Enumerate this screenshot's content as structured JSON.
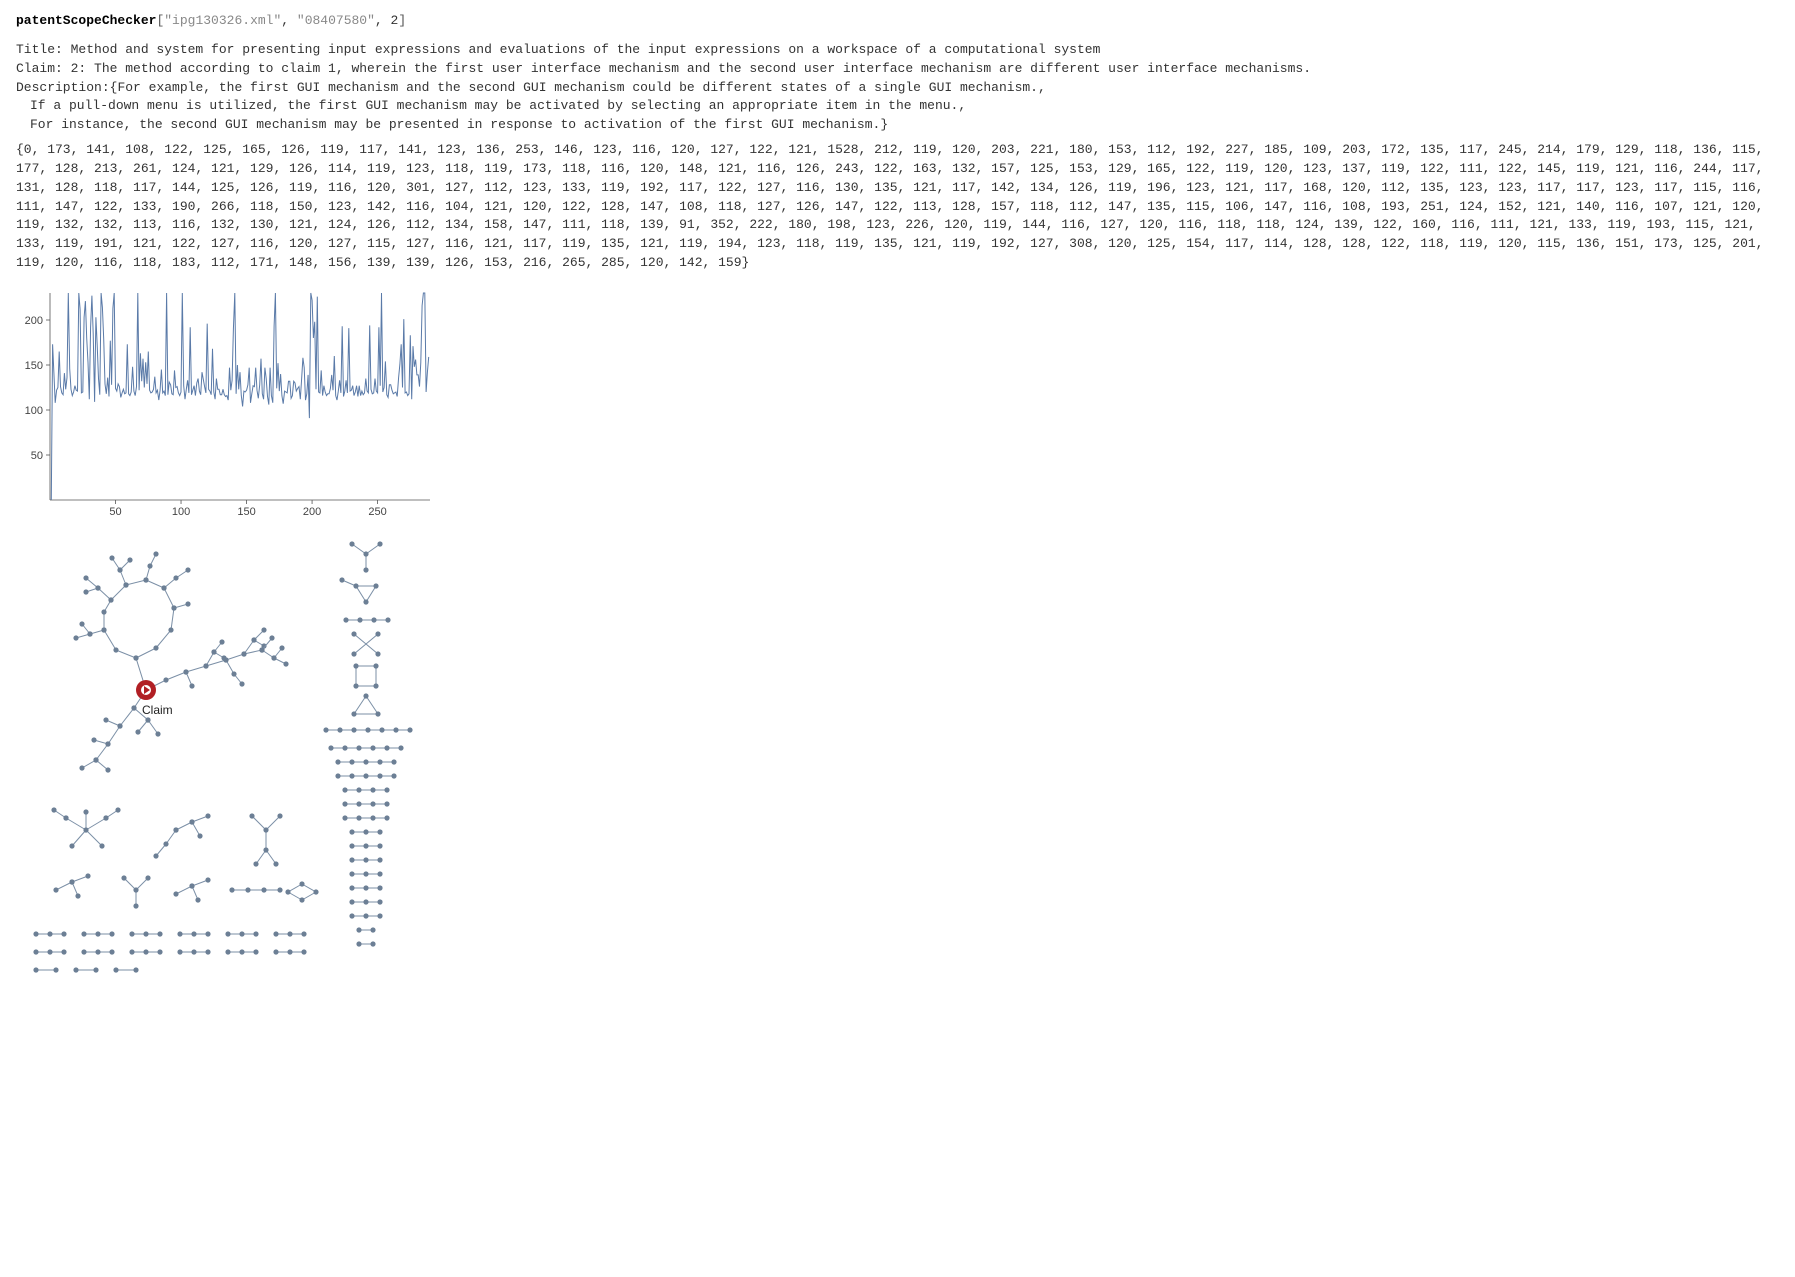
{
  "input": {
    "fn": "patentScopeChecker",
    "arg1": "\"ipg130326.xml\"",
    "arg2": "\"08407580\"",
    "arg3": "2"
  },
  "output": {
    "title_label": "Title: ",
    "title_text": "Method and system for presenting input expressions and evaluations of the input expressions on a workspace of a computational system",
    "claim_label": "Claim: ",
    "claim_text": "2: The method according to claim 1, wherein the first user interface mechanism and the second user interface mechanism are different user interface mechanisms.",
    "desc_label": "Description:",
    "desc_open": "{",
    "desc_items": [
      "For example, the first GUI mechanism and the second GUI mechanism could be different states of a single GUI mechanism.,",
      "If a pull-down menu is utilized, the first GUI mechanism may be activated by selecting an appropriate item in the menu.,",
      "For instance, the second GUI mechanism may be presented in response to activation of the first GUI mechanism."
    ],
    "desc_close": "}"
  },
  "data_list_prefix": "{",
  "data_list_suffix": "}",
  "data_values": [
    0,
    173,
    141,
    108,
    122,
    125,
    165,
    126,
    119,
    117,
    141,
    123,
    136,
    253,
    146,
    123,
    116,
    120,
    127,
    122,
    121,
    1528,
    212,
    119,
    120,
    203,
    221,
    180,
    153,
    112,
    192,
    227,
    185,
    109,
    203,
    172,
    135,
    117,
    245,
    214,
    179,
    129,
    118,
    136,
    115,
    177,
    128,
    213,
    261,
    124,
    121,
    129,
    126,
    114,
    119,
    123,
    118,
    119,
    173,
    118,
    116,
    120,
    148,
    121,
    116,
    126,
    243,
    122,
    163,
    132,
    157,
    125,
    153,
    129,
    165,
    122,
    119,
    120,
    123,
    137,
    119,
    122,
    111,
    122,
    145,
    119,
    121,
    116,
    244,
    117,
    131,
    128,
    118,
    117,
    144,
    125,
    126,
    119,
    116,
    120,
    301,
    127,
    112,
    123,
    133,
    119,
    192,
    117,
    122,
    127,
    116,
    130,
    135,
    121,
    117,
    142,
    134,
    126,
    119,
    196,
    123,
    121,
    117,
    168,
    120,
    112,
    135,
    123,
    123,
    117,
    117,
    123,
    117,
    115,
    116,
    111,
    147,
    122,
    133,
    190,
    266,
    118,
    150,
    123,
    142,
    116,
    104,
    121,
    120,
    122,
    128,
    147,
    108,
    118,
    127,
    126,
    147,
    122,
    113,
    128,
    157,
    118,
    112,
    147,
    135,
    115,
    106,
    147,
    116,
    108,
    193,
    251,
    124,
    152,
    121,
    140,
    116,
    107,
    121,
    120,
    119,
    132,
    132,
    113,
    116,
    132,
    130,
    121,
    124,
    126,
    112,
    134,
    158,
    147,
    111,
    118,
    139,
    91,
    352,
    222,
    180,
    198,
    123,
    226,
    120,
    119,
    144,
    116,
    127,
    120,
    116,
    118,
    118,
    124,
    139,
    122,
    160,
    116,
    111,
    121,
    133,
    119,
    193,
    115,
    121,
    133,
    119,
    191,
    121,
    122,
    127,
    116,
    120,
    127,
    115,
    127,
    116,
    121,
    117,
    119,
    135,
    121,
    119,
    194,
    123,
    118,
    119,
    135,
    121,
    119,
    192,
    127,
    308,
    120,
    125,
    154,
    117,
    114,
    128,
    128,
    122,
    118,
    119,
    120,
    115,
    136,
    151,
    173,
    125,
    201,
    119,
    120,
    116,
    118,
    183,
    112,
    171,
    148,
    156,
    139,
    139,
    126,
    153,
    216,
    265,
    285,
    120,
    142,
    159
  ],
  "chart_data": {
    "type": "line",
    "x_start": 1,
    "x_end": 289,
    "y_ticks": [
      50,
      100,
      150,
      200
    ],
    "x_ticks": [
      50,
      100,
      150,
      200,
      250
    ],
    "ylim": [
      0,
      230
    ],
    "xlim": [
      0,
      290
    ],
    "series": [
      {
        "name": "values",
        "values_ref": "data_values"
      }
    ]
  },
  "graph": {
    "claim_label": "Claim"
  }
}
